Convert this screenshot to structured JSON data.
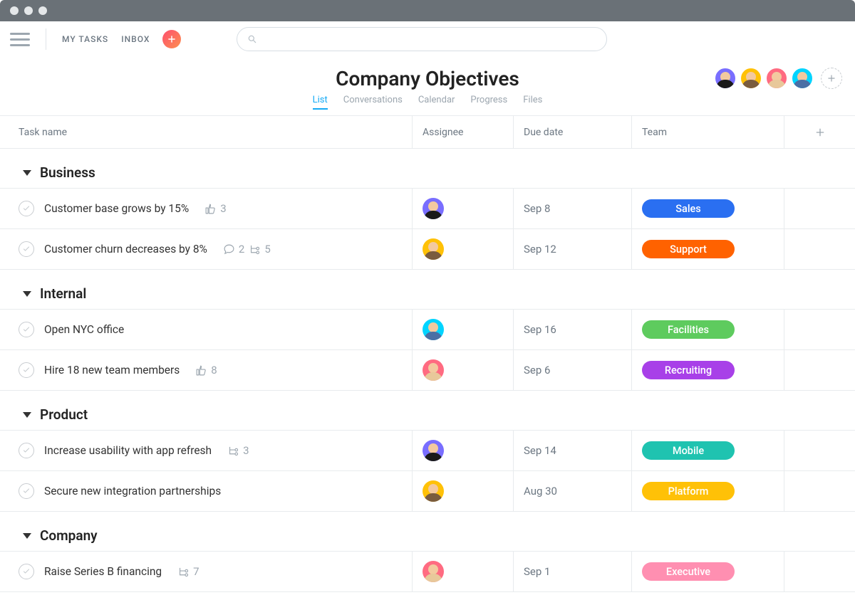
{
  "topnav": {
    "my_tasks": "MY TASKS",
    "inbox": "INBOX",
    "search_placeholder": ""
  },
  "project": {
    "title": "Company Objectives"
  },
  "tabs": [
    {
      "label": "List",
      "active": true
    },
    {
      "label": "Conversations",
      "active": false
    },
    {
      "label": "Calendar",
      "active": false
    },
    {
      "label": "Progress",
      "active": false
    },
    {
      "label": "Files",
      "active": false
    }
  ],
  "columns": {
    "task_name": "Task name",
    "assignee": "Assignee",
    "due_date": "Due date",
    "team": "Team"
  },
  "avatars": {
    "purple": {
      "bg": "#796eff",
      "body": "#1a1a1a"
    },
    "yellow": {
      "bg": "#ffc107",
      "body": "#7a5c3e"
    },
    "coral": {
      "bg": "#ff6b81",
      "body": "#e8c89a"
    },
    "cyan": {
      "bg": "#00d4ff",
      "body": "#4a6fa5"
    }
  },
  "tag_colors": {
    "Sales": "#2a6ff1",
    "Support": "#ff6200",
    "Facilities": "#5ecb5e",
    "Recruiting": "#a840e8",
    "Mobile": "#1fc3b0",
    "Platform": "#ffc107",
    "Executive": "#ff8fb1"
  },
  "sections": [
    {
      "title": "Business",
      "tasks": [
        {
          "name": "Customer base grows by 15%",
          "likes": 3,
          "comments": null,
          "subtasks": null,
          "assignee": "purple",
          "due": "Sep 8",
          "team": "Sales"
        },
        {
          "name": "Customer churn decreases by 8%",
          "likes": null,
          "comments": 2,
          "subtasks": 5,
          "assignee": "yellow",
          "due": "Sep 12",
          "team": "Support"
        }
      ]
    },
    {
      "title": "Internal",
      "tasks": [
        {
          "name": "Open NYC office",
          "likes": null,
          "comments": null,
          "subtasks": null,
          "assignee": "cyan",
          "due": "Sep 16",
          "team": "Facilities"
        },
        {
          "name": "Hire 18 new team members",
          "likes": 8,
          "comments": null,
          "subtasks": null,
          "assignee": "coral",
          "due": "Sep 6",
          "team": "Recruiting"
        }
      ]
    },
    {
      "title": "Product",
      "tasks": [
        {
          "name": "Increase usability with app refresh",
          "likes": null,
          "comments": null,
          "subtasks": 3,
          "assignee": "purple",
          "due": "Sep 14",
          "team": "Mobile"
        },
        {
          "name": "Secure new integration partnerships",
          "likes": null,
          "comments": null,
          "subtasks": null,
          "assignee": "yellow",
          "due": "Aug 30",
          "team": "Platform"
        }
      ]
    },
    {
      "title": "Company",
      "tasks": [
        {
          "name": "Raise Series B financing",
          "likes": null,
          "comments": null,
          "subtasks": 7,
          "assignee": "coral",
          "due": "Sep 1",
          "team": "Executive"
        }
      ]
    }
  ],
  "member_order": [
    "purple",
    "yellow",
    "coral",
    "cyan"
  ]
}
